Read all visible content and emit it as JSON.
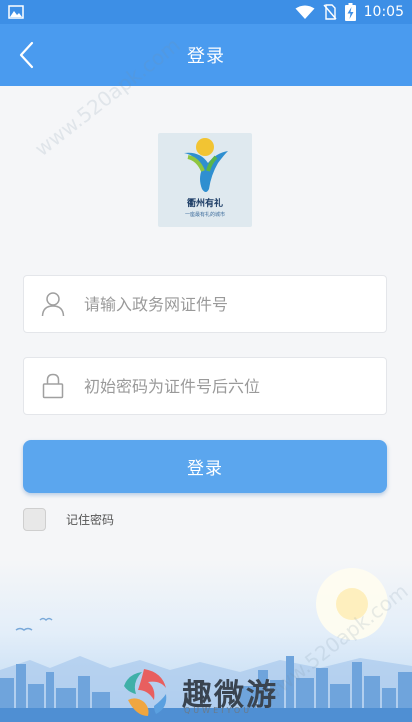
{
  "status_bar": {
    "time": "10:05"
  },
  "header": {
    "title": "登录"
  },
  "logo": {
    "name": "衢州有礼",
    "tagline": "一座最有礼的城市"
  },
  "form": {
    "username_placeholder": "请输入政务网证件号",
    "password_placeholder": "初始密码为证件号后六位",
    "login_label": "登录",
    "remember_label": "记住密码"
  },
  "footer": {
    "brand_name": "趣微游",
    "brand_sub": "QUWEIYOU"
  },
  "watermark": {
    "text": "www.520apk.com"
  },
  "colors": {
    "status_bar": "#3d8fe6",
    "app_bar": "#4a9bef",
    "login_button": "#5ba6ee",
    "background": "#f5f6f8"
  },
  "icons": {
    "back": "chevron-left-icon",
    "user": "user-icon",
    "lock": "lock-icon"
  }
}
